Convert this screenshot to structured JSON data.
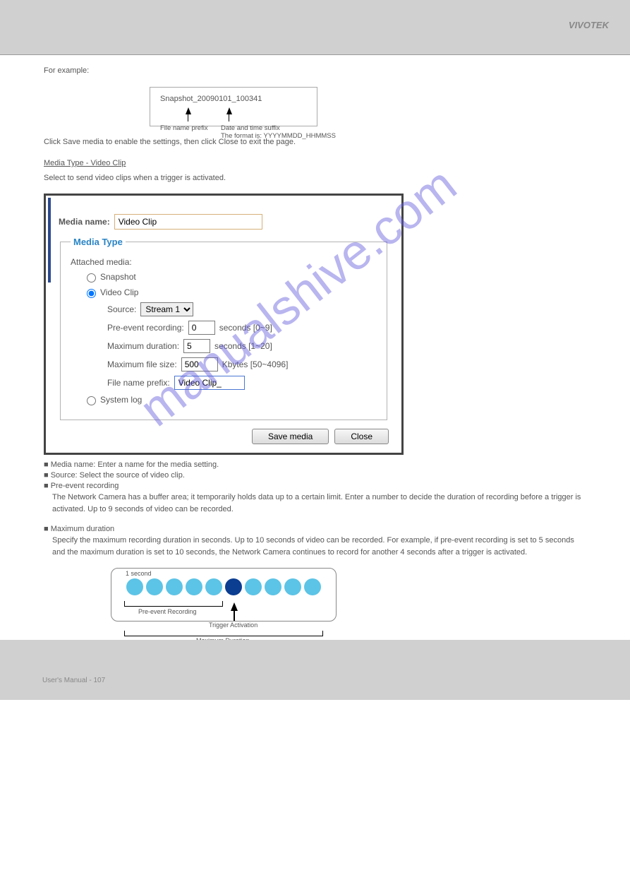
{
  "header": {
    "right_text": "VIVOTEK"
  },
  "intro": {
    "example_label": "For example:"
  },
  "filename_box": {
    "example": "Snapshot_20090101_100341",
    "arrow1_label": "File name prefix",
    "arrow2_label": "Date and time suffix\nThe format is: YYYYMMDD_HHMMSS"
  },
  "section2": {
    "p1": "Click Save media to enable the settings, then click Close to exit the page.",
    "media_type_heading": "Media Type - Video Clip",
    "video_clip_intro": "Select to send video clips when a trigger is activated."
  },
  "dialog": {
    "media_name_label": "Media name:",
    "media_name_value": "Video Clip",
    "media_type_legend": "Media Type",
    "attached_label": "Attached media:",
    "opt_snapshot": "Snapshot",
    "opt_videoclip": "Video Clip",
    "source_label": "Source:",
    "source_value": "Stream 1",
    "pre_event_label": "Pre-event recording:",
    "pre_event_value": "0",
    "pre_event_suffix": "seconds [0~9]",
    "max_dur_label": "Maximum duration:",
    "max_dur_value": "5",
    "max_dur_suffix": "seconds [1~20]",
    "max_size_label": "Maximum file size:",
    "max_size_value": "500",
    "max_size_suffix": "Kbytes [50~4096]",
    "prefix_label": "File name prefix:",
    "prefix_value": "Video Clip_",
    "opt_syslog": "System log",
    "btn_save": "Save media",
    "btn_close": "Close"
  },
  "bullets": {
    "b1": "Media name: Enter a name for the media setting.",
    "b2": "Source: Select the source of video clip.",
    "b3": "Pre-event recording",
    "b3_desc": "The Network Camera has a buffer area; it temporarily holds data up to a certain limit. Enter a number to decide the duration of recording before a trigger is activated. Up to 9 seconds of video can be recorded.",
    "b4": "Maximum duration",
    "b4_desc": "Specify the maximum recording duration in seconds. Up to 10 seconds of video can be recorded. For example, if pre-event recording is set to 5 seconds and the maximum duration is set to 10 seconds, the Network Camera continues to record for another 4 seconds after a trigger is activated."
  },
  "timeline": {
    "top_label": "1 second",
    "trigger_label": "Trigger Activation",
    "pre_label": "Pre-event Recording",
    "max_label": "Maximum Duration"
  },
  "footer": {
    "left": "User's Manual - 107",
    "right": ""
  },
  "watermark": "manualshive.com"
}
